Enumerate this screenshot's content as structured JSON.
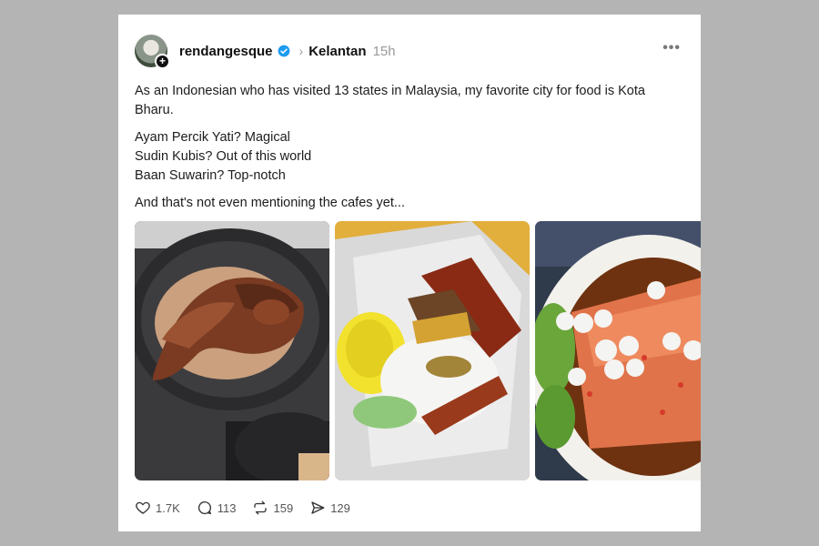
{
  "post": {
    "username": "rendangesque",
    "topic": "Kelantan",
    "time": "15h",
    "more_icon": "more-horizontal-icon",
    "paragraphs": {
      "p1": "As an Indonesian who has visited 13 states in Malaysia, my favorite city for food is Kota Bharu.",
      "line1": "Ayam Percik Yati? Magical",
      "line2": "Sudin Kubis? Out of this world",
      "line3": "Baan Suwarin? Top-notch",
      "p3": "And that's not even mentioning the cafes yet..."
    }
  },
  "actions": {
    "likes": "1.7K",
    "replies": "113",
    "reposts": "159",
    "shares": "129"
  },
  "colors": {
    "background": "#b4b4b4",
    "card": "#ffffff",
    "verified": "#1d9bf0"
  }
}
